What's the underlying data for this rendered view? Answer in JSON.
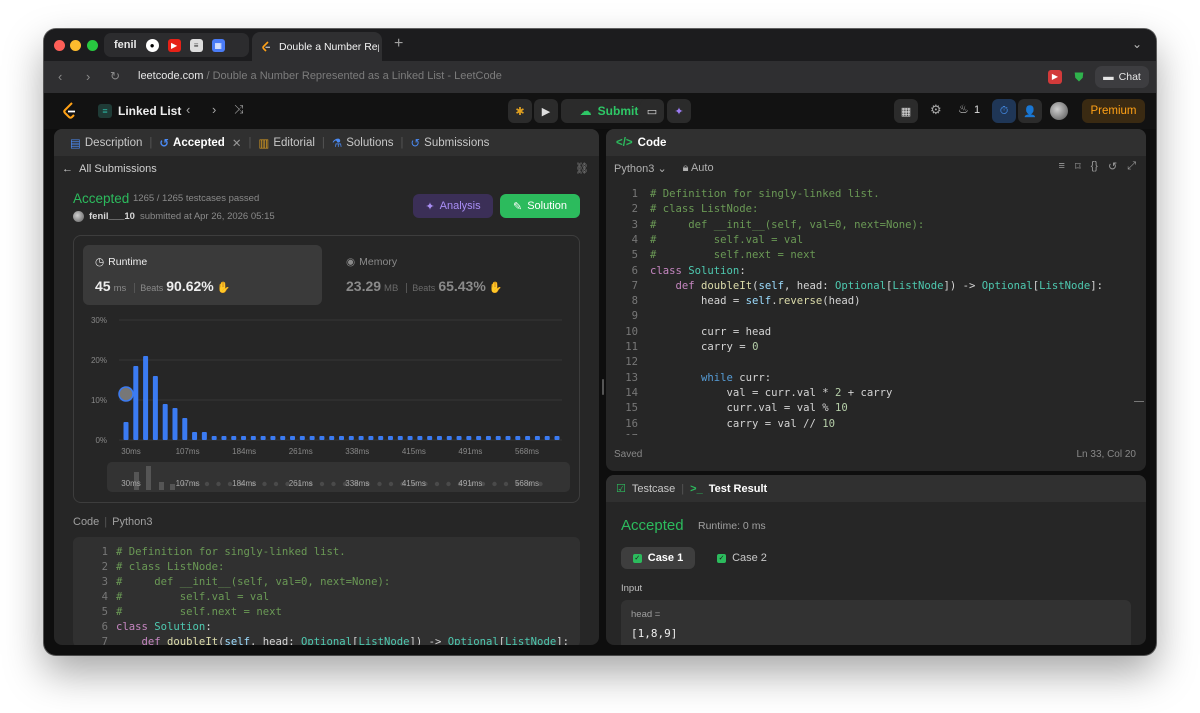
{
  "browser": {
    "tab_group_label": "fenil",
    "active_tab_title": "Double a Number Represe",
    "url_host": "leetcode.com",
    "url_rest": " / Double a Number Represented as a Linked List - LeetCode",
    "chat_label": "Chat"
  },
  "header": {
    "list_title": "Linked List",
    "submit_label": "Submit",
    "streak_count": "1",
    "premium_label": "Premium"
  },
  "left_panel": {
    "tabs": [
      {
        "label": "Description"
      },
      {
        "label": "Accepted"
      },
      {
        "label": "Editorial"
      },
      {
        "label": "Solutions"
      },
      {
        "label": "Submissions"
      }
    ],
    "all_submissions": "All Submissions",
    "status": "Accepted",
    "testcases": "1265 / 1265 testcases passed",
    "username": "fenil___10",
    "submitted_at": "submitted at Apr 26, 2026 05:15",
    "analysis_label": "Analysis",
    "solution_label": "Solution",
    "runtime": {
      "label": "Runtime",
      "value": "45",
      "unit": "ms",
      "beats_label": "Beats",
      "percent": "90.62%"
    },
    "memory": {
      "label": "Memory",
      "value": "23.29",
      "unit": "MB",
      "beats_label": "Beats",
      "percent": "65.43%"
    },
    "code_label": "Code",
    "code_lang": "Python3"
  },
  "chart_data": {
    "type": "bar",
    "title": "",
    "xlabel": "",
    "ylabel": "",
    "ylim": [
      0,
      30
    ],
    "y_ticks": [
      "30%",
      "20%",
      "10%",
      "0%"
    ],
    "x_ticks": [
      "30ms",
      "107ms",
      "184ms",
      "261ms",
      "338ms",
      "415ms",
      "491ms",
      "568ms"
    ],
    "values": [
      4.5,
      18.5,
      21,
      16,
      9,
      8,
      5.5,
      2,
      2,
      1,
      1,
      1,
      1,
      1,
      1,
      1,
      1,
      1,
      1,
      1,
      1,
      1,
      1,
      1,
      1,
      1,
      1,
      1,
      1,
      1,
      1,
      1,
      1,
      1,
      1,
      1,
      1,
      1,
      1,
      1,
      1,
      1,
      1,
      1,
      1
    ],
    "highlight_index": 0,
    "highlight_color": "#3b7bf2",
    "bar_color": "#3b7bf2",
    "grid": true
  },
  "left_code": [
    "# Definition for singly-linked list.",
    "# class ListNode:",
    "#     def __init__(self, val=0, next=None):",
    "#         self.val = val",
    "#         self.next = next",
    "class Solution:",
    "    def doubleIt(self, head: Optional[ListNode]) -> Optional[ListNode]:"
  ],
  "editor": {
    "tab_label": "Code",
    "language": "Python3",
    "mode": "Auto",
    "saved": "Saved",
    "cursor": "Ln 33, Col 20",
    "lines": [
      "# Definition for singly-linked list.",
      "# class ListNode:",
      "#     def __init__(self, val=0, next=None):",
      "#         self.val = val",
      "#         self.next = next",
      "class Solution:",
      "    def doubleIt(self, head: Optional[ListNode]) -> Optional[ListNode]:",
      "        head = self.reverse(head)",
      "",
      "        curr = head",
      "        carry = 0",
      "",
      "        while curr:",
      "            val = curr.val * 2 + carry",
      "            curr.val = val % 10",
      "            carry = val // 10",
      ""
    ]
  },
  "result": {
    "testcase_tab": "Testcase",
    "result_tab": "Test Result",
    "status": "Accepted",
    "runtime": "Runtime: 0 ms",
    "case1": "Case 1",
    "case2": "Case 2",
    "input_label": "Input",
    "input_key": "head =",
    "input_value": "[1,8,9]"
  },
  "colors": {
    "accent_green": "#2cbb5d",
    "premium": "#ffa116",
    "bar_blue": "#3b7bf2"
  }
}
